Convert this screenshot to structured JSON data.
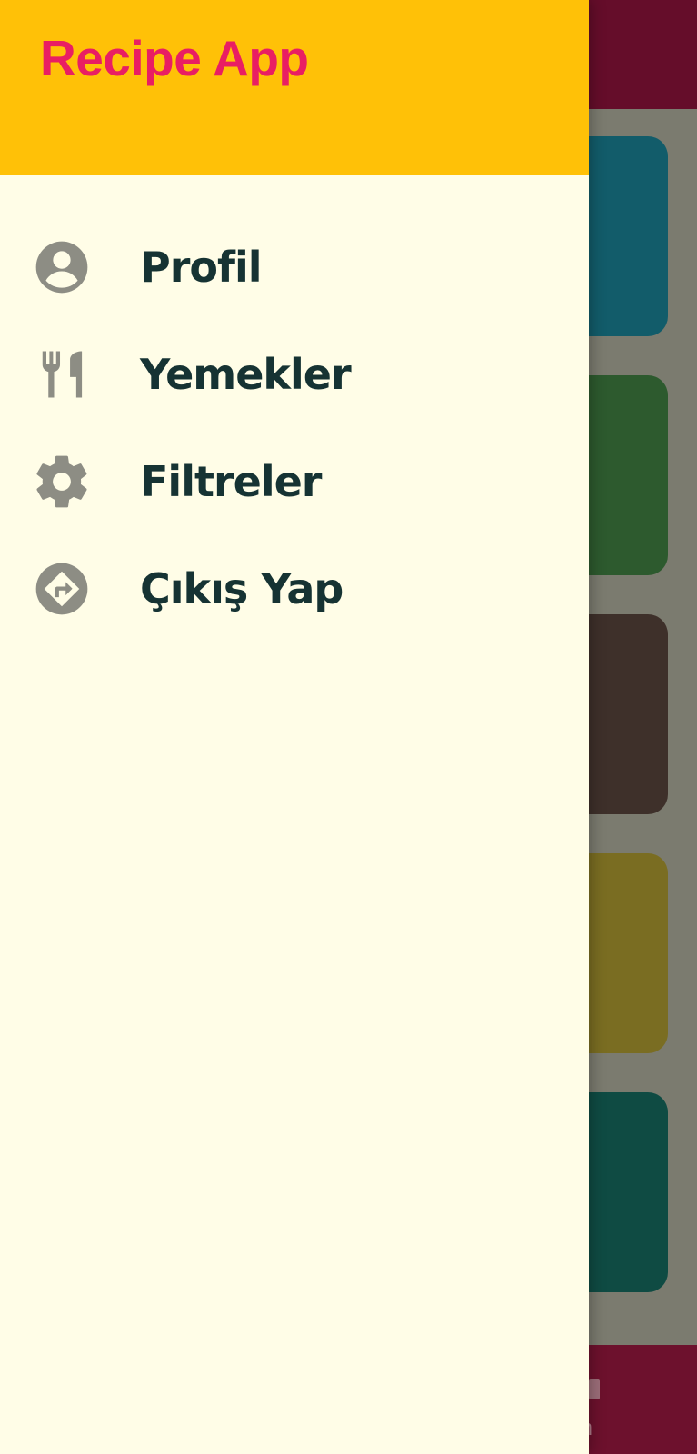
{
  "drawer": {
    "title": "Recipe App",
    "items": [
      {
        "label": "Profil",
        "icon": "account-circle-icon"
      },
      {
        "label": "Yemekler",
        "icon": "restaurant-icon"
      },
      {
        "label": "Filtreler",
        "icon": "settings-icon"
      },
      {
        "label": "Çıkış Yap",
        "icon": "directions-icon"
      }
    ]
  },
  "background": {
    "bottom_nav_label_partial": "lerim"
  },
  "colors": {
    "header_bg": "#ffc107",
    "title": "#e91e63",
    "drawer_bg": "#fffde7",
    "label": "#163333",
    "icon": "#8d8d84",
    "appbar": "#650d2a",
    "card_colors": [
      "#125c6a",
      "#2d5a2e",
      "#3e302a",
      "#7a6d22",
      "#0f4b43"
    ]
  }
}
